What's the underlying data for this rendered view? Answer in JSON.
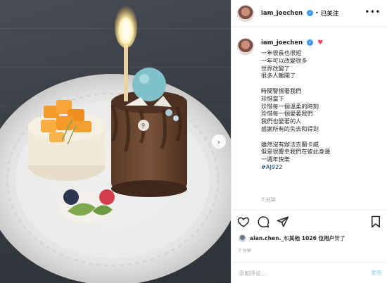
{
  "post": {
    "username": "iam_joechen",
    "follow_status": "已关注",
    "dot": "•",
    "more_icon": "more-icon",
    "photo_description_icon": "cake-photo"
  },
  "caption": {
    "lines": [
      "一年很長也很短",
      "一年可以改變很多",
      "世界改變了",
      "很多人離開了",
      "",
      "時間警惕著我們",
      "珍惜當下",
      "珍惜每一個溫柔的時刻",
      "珍惜每一個愛著我們",
      "我們也愛著的人",
      "感謝所有的失去和得到",
      "",
      "雖然沒有辦法去蘭卡威",
      "但是很慶幸我們在彼此身邊",
      "一週年快樂"
    ],
    "hashtag": "#AJ922",
    "time": "7 分钟"
  },
  "likes": {
    "liker": "alan.chen._",
    "connector": " 和 ",
    "others": "其他 1026 位用户",
    "suffix": " 赞了"
  },
  "post_time": "7 分钟",
  "comment": {
    "placeholder": "添加评论...",
    "post_label": "发布"
  },
  "colors": {
    "verified": "#3897f0",
    "heart": "#ed4956",
    "link": "#00376b",
    "post_button": "#b2dffc"
  }
}
